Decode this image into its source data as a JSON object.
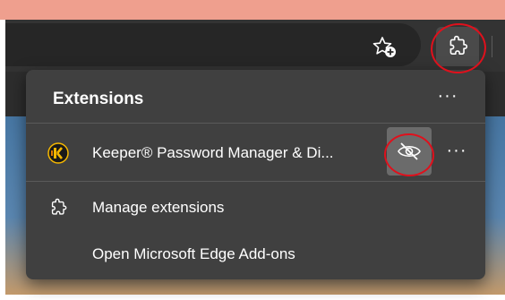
{
  "toolbar": {
    "favorites_icon": "star-plus-icon",
    "extensions_icon": "puzzle-icon"
  },
  "extensions_panel": {
    "title": "Extensions",
    "more_label": "···",
    "items": [
      {
        "name": "Keeper® Password Manager & Di...",
        "icon": "keeper-logo-icon",
        "hide_icon": "eye-hidden-icon",
        "more_label": "···"
      }
    ],
    "manage_label": "Manage extensions",
    "manage_icon": "puzzle-icon",
    "addons_label": "Open Microsoft Edge Add-ons"
  },
  "colors": {
    "window_frame": "#ef9f8e",
    "toolbar": "#333333",
    "panel": "#404040",
    "annotation": "#e0101c",
    "keeper_yellow": "#f5b700"
  }
}
